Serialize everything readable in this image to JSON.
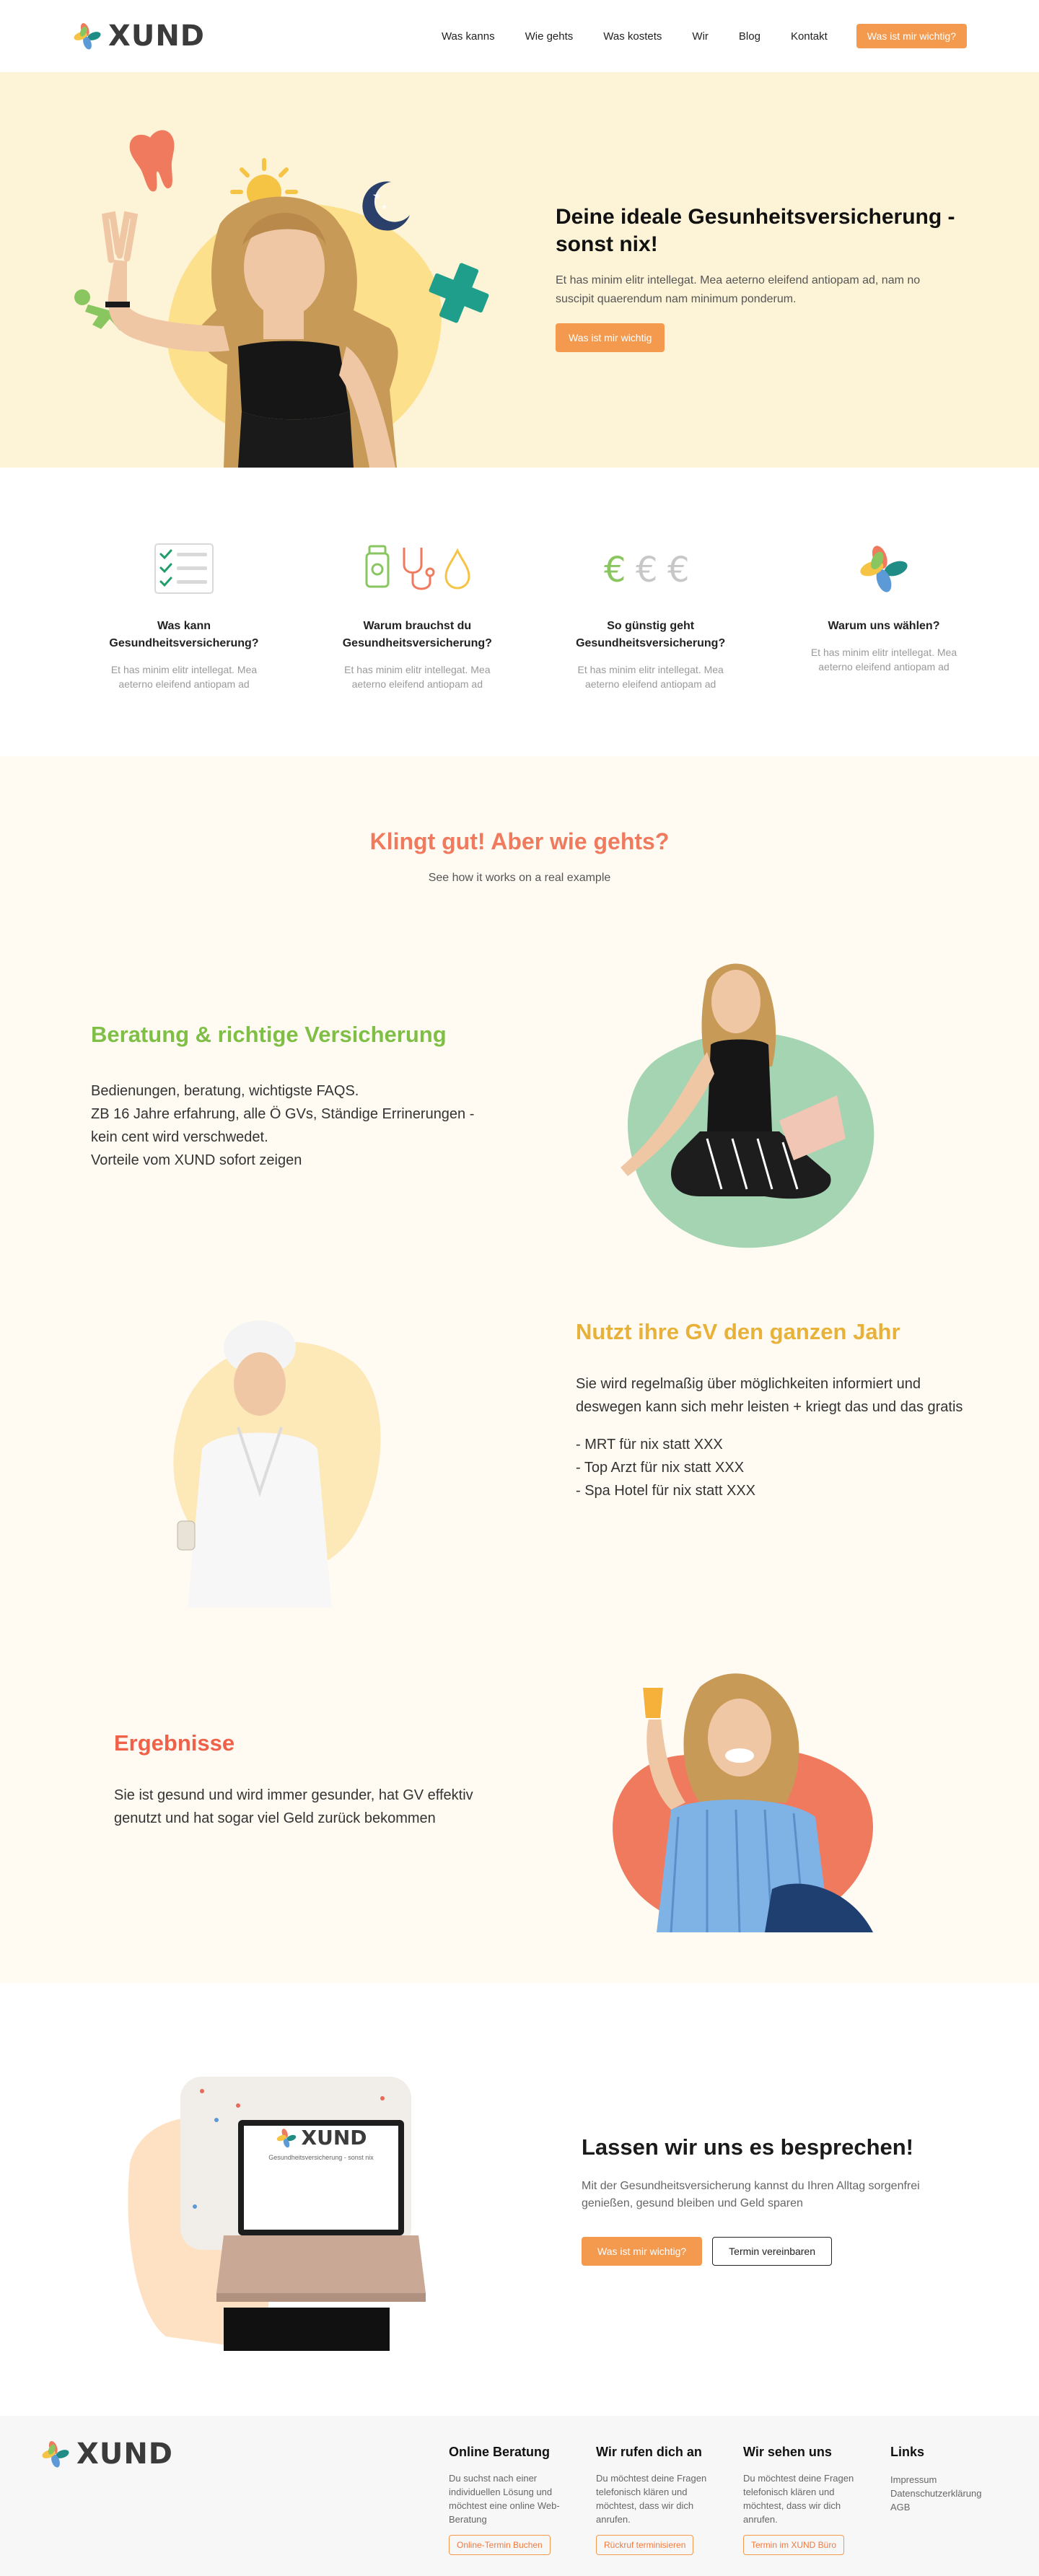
{
  "brand": {
    "name": "XUND"
  },
  "nav": {
    "links": [
      "Was kanns",
      "Wie gehts",
      "Was kostets",
      "Wir",
      "Blog",
      "Kontakt"
    ],
    "cta": "Was ist mir wichtig?"
  },
  "hero": {
    "title": "Deine ideale Gesunheitsversicherung - sonst nix!",
    "description": "Et has minim elitr intellegat. Mea aeterno eleifend antiopam ad, nam no suscipit quaerendum nam minimum ponderum.",
    "cta": "Was ist mir wichtig"
  },
  "features": [
    {
      "title": "Was kann Gesundheitsversicherung?",
      "desc": "Et has minim elitr intellegat. Mea aeterno eleifend antiopam ad",
      "icon": "checklist-icon"
    },
    {
      "title": "Warum brauchst du Gesundheitsversicherung?",
      "desc": "Et has minim elitr intellegat. Mea aeterno eleifend antiopam ad",
      "icon": "health-items-icon"
    },
    {
      "title": "So günstig geht Gesundheitsversicherung?",
      "desc": "Et has minim elitr intellegat. Mea aeterno eleifend antiopam ad",
      "icon": "euro-icon"
    },
    {
      "title": "Warum uns wählen?",
      "desc": "Et has minim elitr intellegat. Mea aeterno eleifend antiopam ad",
      "icon": "xund-flower-icon"
    }
  ],
  "how": {
    "title": "Klingt gut! Aber wie gehts?",
    "subtitle": "See how it works on a real example",
    "blocks": [
      {
        "title": "Beratung & richtige Versicherung",
        "color": "#7fbf46",
        "lines": [
          "Bedienungen, beratung, wichtigste FAQS.",
          "ZB 16 Jahre erfahrung, alle Ö GVs, Ständige Errinerungen - kein cent wird verschwedet.",
          "Vorteile vom XUND sofort zeigen"
        ]
      },
      {
        "title": "Nutzt ihre GV den ganzen Jahr",
        "color": "#e8b13a",
        "lines": [
          "Sie wird regelmaßig über möglichkeiten informiert und deswegen kann sich mehr leisten + kriegt das und das gratis",
          "- MRT für nix statt XXX",
          "- Top Arzt für nix statt XXX",
          "- Spa Hotel für nix statt XXX"
        ]
      },
      {
        "title": "Ergebnisse",
        "color": "#f0614a",
        "lines": [
          "Sie ist gesund und wird immer gesunder, hat GV effektiv genutzt und hat sogar viel Geld zurück bekommen"
        ]
      }
    ]
  },
  "contact": {
    "title": "Lassen wir uns es besprechen!",
    "description": "Mit der Gesundheitsversicherung kannst du Ihren Alltag sorgenfrei genießen, gesund bleiben und Geld sparen",
    "primary": "Was ist mir wichtig?",
    "secondary": "Termin vereinbaren",
    "laptop_brand": "XUND",
    "laptop_tagline": "Gesundheitsversicherung - sonst nix"
  },
  "footer": {
    "columns": [
      {
        "title": "Online Beratung",
        "text": "Du suchst nach einer individuellen Lösung und möchtest eine online Web-Beratung",
        "button": "Online-Termin Buchen"
      },
      {
        "title": "Wir rufen dich an",
        "text": "Du möchtest deine Fragen telefonisch klären und möchtest, dass wir dich anrufen.",
        "button": "Rückruf terminisieren"
      },
      {
        "title": "Wir sehen uns",
        "text": "Du möchtest deine Fragen telefonisch klären und möchtest, dass wir dich anrufen.",
        "button": "Termin im XUND Büro"
      }
    ],
    "links_title": "Links",
    "links": [
      "Impressum",
      "Datenschutzerklärung",
      "AGB"
    ]
  }
}
